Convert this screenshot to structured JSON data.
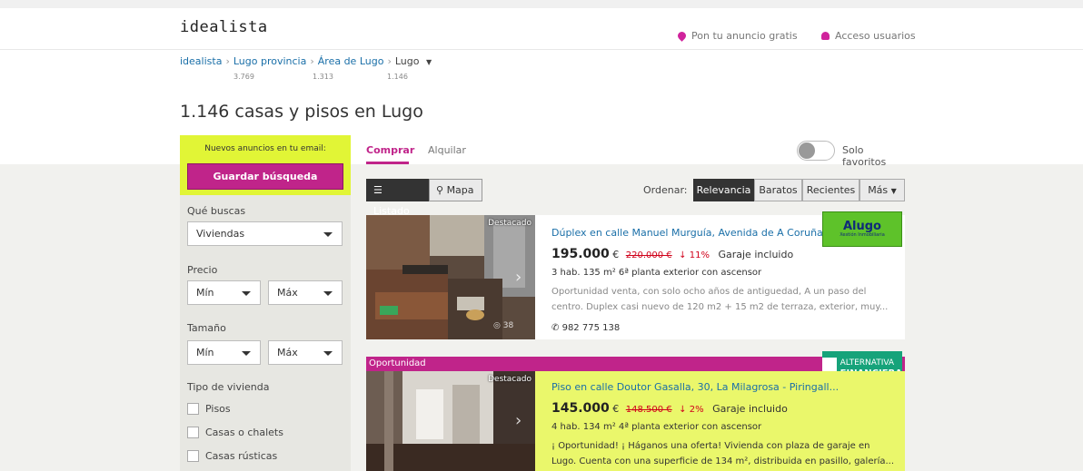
{
  "header": {
    "logo": "idealista",
    "post_ad": "Pon tu anuncio gratis",
    "login": "Acceso usuarios"
  },
  "breadcrumb": {
    "items": [
      {
        "label": "idealista"
      },
      {
        "label": "Lugo provincia",
        "count": "3.769"
      },
      {
        "label": "Área de Lugo",
        "count": "1.313"
      },
      {
        "label": "Lugo",
        "count": "1.146"
      }
    ]
  },
  "page_title": "1.146 casas y pisos en Lugo",
  "sidebar": {
    "email_label": "Nuevos anuncios en tu email:",
    "save_label": "Guardar búsqueda",
    "que_buscas": "Qué buscas",
    "type_value": "Viviendas",
    "precio": "Precio",
    "min": "Mín",
    "max": "Máx",
    "tamano": "Tamaño",
    "tipo_vivienda": "Tipo de vivienda",
    "checks": [
      "Pisos",
      "Casas o chalets",
      "Casas rústicas"
    ]
  },
  "tabs": {
    "buy": "Comprar",
    "rent": "Alquilar",
    "favorites": "Solo favoritos"
  },
  "toolbar": {
    "list": "Listado",
    "map": "Mapa",
    "sort_label": "Ordenar:",
    "sort": [
      "Relevancia",
      "Baratos",
      "Recientes",
      "Más"
    ]
  },
  "listings": [
    {
      "badge": "Destacado",
      "title": "Dúplex en calle Manuel Murguía, Avenida de A Coruña, ...",
      "price": "195.000",
      "currency": "€",
      "old_price": "220.000 €",
      "drop": "↓ 11%",
      "garage": "Garaje incluido",
      "details": "3 hab.  135 m²  6ª planta exterior con ascensor",
      "desc": "Oportunidad venta, con solo ocho años de antiguedad, A un paso del centro. Duplex casi nuevo de 120 m2 + 15 m2 de terraza, exterior, muy...",
      "phone": "982 775 138",
      "agency": "Alugo",
      "agency_sub": "Xestión Inmobiliaria",
      "photos": "38"
    },
    {
      "banner": "Oportunidad",
      "badge": "Destacado",
      "title": "Piso en calle Doutor Gasalla, 30, La Milagrosa - Piringall...",
      "price": "145.000",
      "currency": "€",
      "old_price": "148.500 €",
      "drop": "↓ 2%",
      "garage": "Garaje incluido",
      "details": "4 hab.  134 m²  4ª planta exterior con ascensor",
      "desc": "¡ Oportunidad! ¡ Háganos una oferta! Vivienda con plaza de garaje en Lugo. Cuenta con una superficie de 134 m², distribuida en pasillo, galería...",
      "agency": "ALTERNATIVA",
      "agency_sub": "FINANCIERA"
    }
  ],
  "colors": {
    "brand": "#c0248a",
    "lime": "#e1f536",
    "link": "#1a6fa8",
    "price_drop": "#d0021b"
  }
}
